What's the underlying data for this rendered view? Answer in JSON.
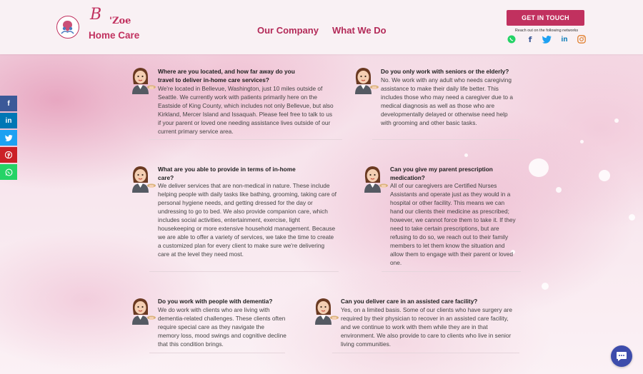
{
  "brand": {
    "logo_letter": "B",
    "logo_name": "'Zoe",
    "logo_subtitle": "Home Care"
  },
  "nav": {
    "our_company": "Our Company",
    "what_we_do": "What We Do"
  },
  "header_cta": {
    "button": "GET IN TOUCH",
    "networks_note": "Reach out on the following networks"
  },
  "header_social": [
    "whatsapp-icon",
    "facebook-icon",
    "twitter-icon",
    "linkedin-icon",
    "instagram-icon"
  ],
  "side_share": [
    {
      "icon": "facebook-icon",
      "glyph": "f",
      "color": "#3b5998"
    },
    {
      "icon": "linkedin-icon",
      "glyph": "in",
      "color": "#0077b5"
    },
    {
      "icon": "twitter-icon",
      "glyph": "t",
      "color": "#1da1f2"
    },
    {
      "icon": "pinterest-icon",
      "glyph": "P",
      "color": "#cb2027"
    },
    {
      "icon": "whatsapp-icon",
      "glyph": "w",
      "color": "#25d366"
    }
  ],
  "faqs": [
    {
      "question": "Where are you located, and how far away do you travel to deliver in-home care services?",
      "answer": "We're located in Bellevue, Washington, just 10 miles outside of Seattle. We currently work with patients primarily here on the Eastside of King County, which includes not only Bellevue, but also Kirkland, Mercer Island and Issaquah. Please feel free to talk to us if your parent or loved one needing assistance lives outside of our current primary service area."
    },
    {
      "question": "Do you only work with seniors or the elderly?",
      "answer": "No. We work with any adult who needs caregiving assistance to make their daily life better. This includes those who may need a caregiver due to a medical diagnosis as well as those who are developmentally delayed or otherwise need help with grooming and other basic tasks."
    },
    {
      "question": "What are you able to provide in terms of in-home care?",
      "answer": "We deliver services that are non-medical in nature. These include helping people with daily tasks like bathing, grooming, taking care of personal hygiene needs, and getting dressed for the day or undressing to go to bed. We also provide companion care, which includes social activities, entertainment, exercise, light housekeeping or more extensive household management. Because we are able to offer a variety of services, we take the time to create a customized plan for every client to make sure we're delivering care at the level they need most."
    },
    {
      "question": "Can you give my parent prescription medication?",
      "answer": "All of our caregivers are Certified Nurses Assistants and operate just as they would in a hospital or other facility. This means we can hand our clients their medicine as prescribed; however, we cannot force them to take it. If they need to take certain prescriptions, but are refusing to do so, we reach out to their family members to let them know the situation and allow them to engage with their parent or loved one."
    },
    {
      "question": "Do you work with people with dementia?",
      "answer": "We do work with clients who are living with dementia-related challenges. These clients often require special care as they navigate the memory loss, mood swings and cognitive decline that this condition brings."
    },
    {
      "question": "Can you deliver care in an assisted care facility?",
      "answer": "Yes, on a limited basis. Some of our clients who have surgery are required by their physician to recover in an assisted care facility, and we continue to work with them while they are in that environment. We also provide to care to clients who live in senior living communities."
    }
  ],
  "colors": {
    "brand": "#c1315f",
    "nav": "#b32a58",
    "chat": "#3d4cab"
  }
}
